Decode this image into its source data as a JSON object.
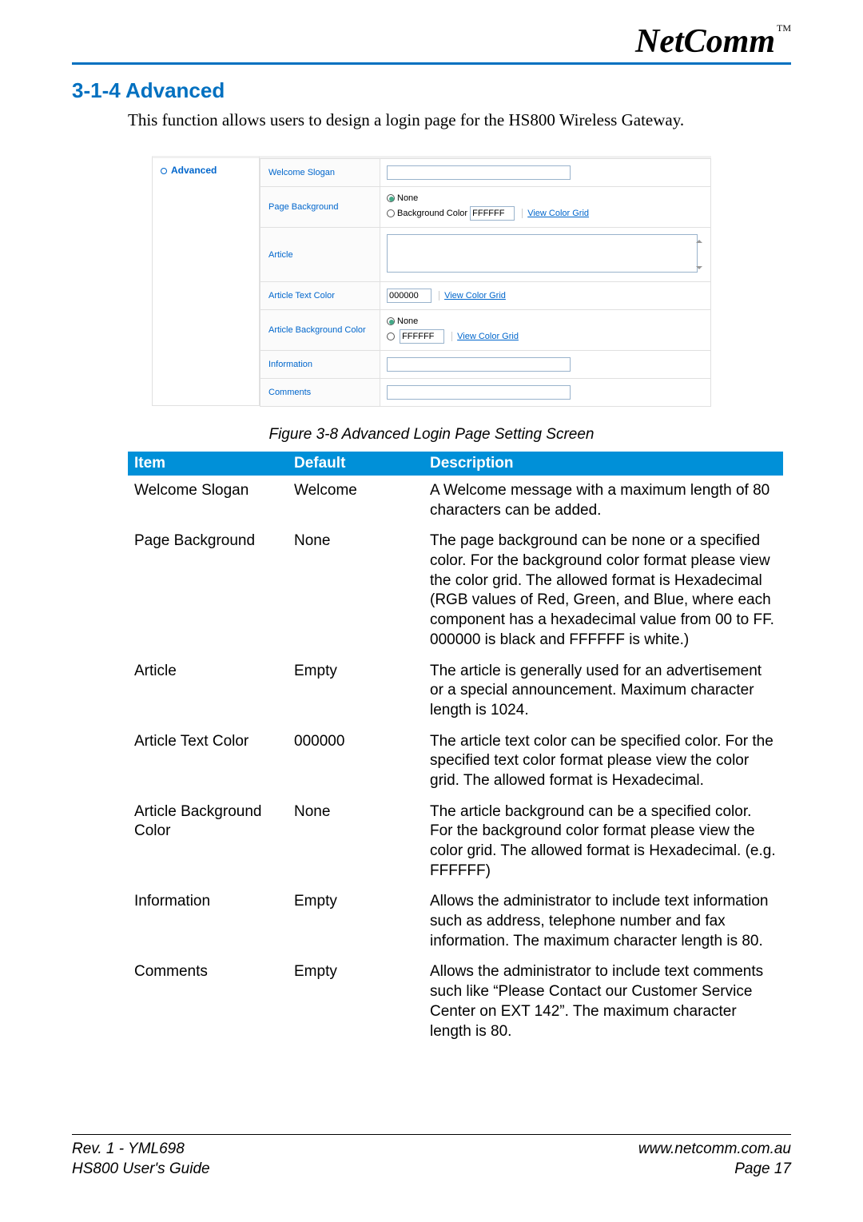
{
  "header": {
    "logo_text": "NetComm",
    "logo_tm": "TM"
  },
  "section": {
    "number_title": "3-1-4  Advanced",
    "intro": "This function allows users to design a login page for the HS800 Wireless Gateway."
  },
  "figure": {
    "sidebar_label": "Advanced",
    "rows": {
      "welcome_slogan_label": "Welcome Slogan",
      "page_background_label": "Page Background",
      "page_bg_none": "None",
      "page_bg_color_label": "Background Color",
      "page_bg_color_value": "FFFFFF",
      "view_color_grid": "View Color Grid",
      "article_label": "Article",
      "article_text_color_label": "Article Text Color",
      "article_text_color_value": "000000",
      "article_bg_color_label": "Article Background Color",
      "article_bg_none": "None",
      "article_bg_value": "FFFFFF",
      "information_label": "Information",
      "comments_label": "Comments"
    },
    "caption": "Figure 3-8 Advanced Login Page Setting Screen"
  },
  "table": {
    "headers": {
      "item": "Item",
      "default": "Default",
      "description": "Description"
    },
    "rows": [
      {
        "item": "Welcome Slogan",
        "default": "Welcome",
        "description": "A Welcome message with a maximum length of 80 characters can be added."
      },
      {
        "item": "Page Background",
        "default": "None",
        "description": "The page background can be none or a specified color. For the background color format please view  the color grid. The allowed format is Hexadecimal (RGB values of Red, Green, and Blue, where each component has a hexadecimal value from 00 to FF. 000000 is black and FFFFFF is white.)"
      },
      {
        "item": "Article",
        "default": "Empty",
        "description": "The article is generally used for an advertisement or a special announcement. Maximum character length is 1024."
      },
      {
        "item": "Article Text Color",
        "default": "000000",
        "description": "The article text color can be specified color. For the specified text color format please view the color grid. The allowed format is Hexadecimal."
      },
      {
        "item": "Article Background Color",
        "default": "None",
        "description": "The article background can be a specified color. For the background color format please view the color grid. The allowed format is Hexadecimal.  (e.g. FFFFFF)"
      },
      {
        "item": "Information",
        "default": "Empty",
        "description": "Allows the administrator to include text information such as address, telephone number and fax information. The maximum character length is 80."
      },
      {
        "item": "Comments",
        "default": "Empty",
        "description": "Allows the administrator to include text comments such like “Please Contact our Customer Service Center on  EXT 142”. The maximum character length is 80."
      }
    ]
  },
  "footer": {
    "left_line1": "Rev. 1 - YML698",
    "left_line2": "HS800 User's Guide",
    "right_line1": "www.netcomm.com.au",
    "right_line2": "Page 17"
  }
}
